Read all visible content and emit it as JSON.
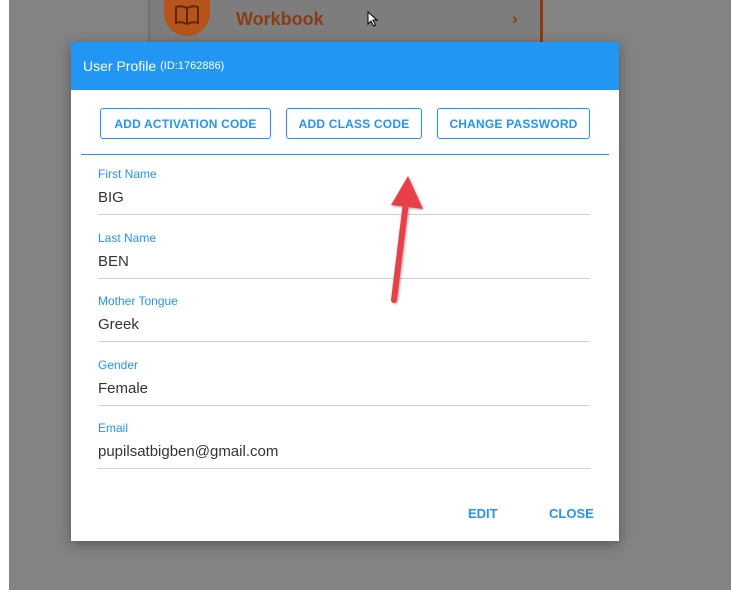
{
  "background": {
    "card_label": "Workbook",
    "card_chevron": "›",
    "card_icon": "book-icon",
    "accent_color": "#b8531c"
  },
  "dialog": {
    "title": "User Profile",
    "id_text": "(ID:1762886)",
    "header_color": "#2196f3",
    "actions": {
      "activation_label": "ADD ACTIVATION CODE",
      "class_code_label": "ADD CLASS CODE",
      "password_label": "CHANGE PASSWORD"
    },
    "fields": [
      {
        "label": "First Name",
        "value": "BIG"
      },
      {
        "label": "Last Name",
        "value": "BEN"
      },
      {
        "label": "Mother Tongue",
        "value": "Greek"
      },
      {
        "label": "Gender",
        "value": "Female"
      },
      {
        "label": "Email",
        "value": "pupilsatbigben@gmail.com"
      }
    ],
    "footer": {
      "edit_label": "EDIT",
      "close_label": "CLOSE"
    }
  },
  "annotation": {
    "color": "#e8404a",
    "icon": "red-arrow-icon"
  }
}
